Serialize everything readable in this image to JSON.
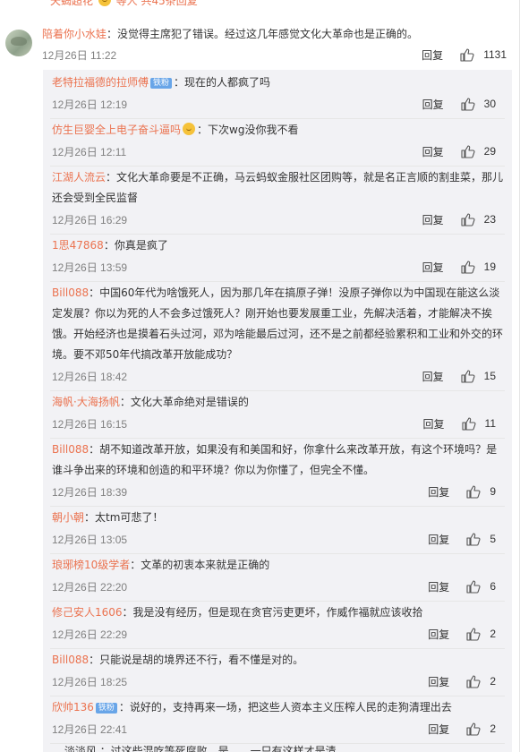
{
  "top_partial": {
    "name": "天蝎超花",
    "rest": "等人 共45条回复"
  },
  "main": {
    "username": "陪着你小水娃",
    "text": "：没觉得主席犯了错误。经过这几年感觉文化大革命也是正确的。",
    "time": "12月26日 11:22",
    "reply": "回复",
    "likes": "1131"
  },
  "replies": [
    {
      "username": "老特拉福德的拉师傅",
      "badge": "铁粉",
      "text": "：现在的人都疯了吗",
      "time": "12月26日 12:19",
      "reply": "回复",
      "likes": "30"
    },
    {
      "username": "仿生巨婴全上电子奋斗逼吗",
      "emoji": true,
      "text": "：下次wg没你我不看",
      "time": "12月26日 12:11",
      "reply": "回复",
      "likes": "29"
    },
    {
      "username": "江湖人流云",
      "text": "：文化大革命要是不正确，马云蚂蚁金服社区团购等，就是名正言顺的割韭菜，那儿还会受到全民监督",
      "time": "12月26日 16:29",
      "reply": "回复",
      "likes": "23"
    },
    {
      "username": "1思47868",
      "text": "：你真是疯了",
      "time": "12月26日 13:59",
      "reply": "回复",
      "likes": "19"
    },
    {
      "username": "Bill088",
      "text": "：中国60年代为啥饿死人，因为那几年在搞原子弹！没原子弹你以为中国现在能这么淡定发展？你以为死的人不会多过饿死人？刚开始也要发展重工业，先解决活着，才能解决不挨饿。开始经济也是摸着石头过河，邓为啥能最后过河，还不是之前都经验累积和工业和外交的环境。要不邓50年代搞改革开放能成功？",
      "time": "12月26日 18:42",
      "reply": "回复",
      "likes": "15"
    },
    {
      "username": "海帆·大海扬帆",
      "text": "：文化大革命绝对是错误的",
      "time": "12月26日 16:15",
      "reply": "回复",
      "likes": "11"
    },
    {
      "username": "Bill088",
      "text": "：胡不知道改革开放，如果没有和美国和好，你拿什么来改革开放，有这个环境吗？是谁斗争出来的环境和创造的和平环境？你以为你懂了，但完全不懂。",
      "time": "12月26日 18:39",
      "reply": "回复",
      "likes": "9"
    },
    {
      "username": "朝小朝",
      "text": "：太tm可悲了！",
      "time": "12月26日 13:05",
      "reply": "回复",
      "likes": "5"
    },
    {
      "username": "琅琊榜10级学者",
      "text": "：文革的初衷本来就是正确的",
      "time": "12月26日 22:20",
      "reply": "回复",
      "likes": "6"
    },
    {
      "username": "修己安人1606",
      "text": "：我是没有经历，但是现在贪官污吏更坏，作威作福就应该收拾",
      "time": "12月26日 22:29",
      "reply": "回复",
      "likes": "2"
    },
    {
      "username": "Bill088",
      "text": "：只能说是胡的境界还不行，看不懂是对的。",
      "time": "12月26日 18:25",
      "reply": "回复",
      "likes": "2"
    },
    {
      "username": "欣帅136",
      "badge": "铁粉",
      "text": "：说好的，支持再来一场，把这些人资本主义压榨人民的走狗清理出去",
      "time": "12月26日 22:41",
      "reply": "回复",
      "likes": "2"
    }
  ],
  "bottom_partial": "… 淡淡风 ：过这些混吃等死腐败，是……一只有这样才是清……"
}
